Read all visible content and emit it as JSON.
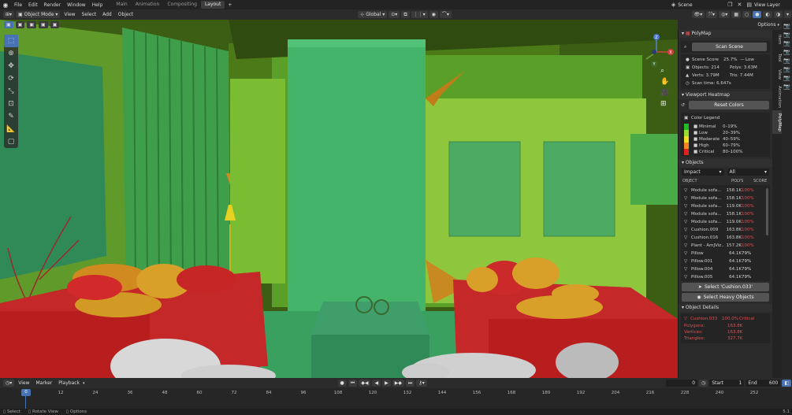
{
  "topbar": {
    "menus": [
      "File",
      "Edit",
      "Render",
      "Window",
      "Help"
    ],
    "workspaces": [
      "Main",
      "Animation",
      "Compositing",
      "Layout"
    ],
    "active_workspace": "Layout",
    "add_tab": "+",
    "scene": "Scene",
    "view_layer": "View Layer"
  },
  "header": {
    "mode": "Object Mode",
    "menus": [
      "View",
      "Select",
      "Add",
      "Object"
    ],
    "transform": "Global",
    "options": "Options"
  },
  "navigator": {
    "x_label": "X",
    "y_label": "Y",
    "z_label": "Z"
  },
  "polymap": {
    "title": "PolyMap",
    "scan_button": "Scan Scene",
    "stats": {
      "score_label": "Scene Score",
      "score_value": "25.7%",
      "score_rating": "Low",
      "objects": "Objects: 214",
      "polys": "Polys: 3.63M",
      "verts": "Verts: 3.79M",
      "tris": "Tris: 7.44M",
      "scan_time": "Scan time: 6.647s"
    },
    "heatmap_section": "Viewport Heatmap",
    "reset_button": "Reset Colors",
    "legend_title": "Color Legend",
    "legend": [
      {
        "name": "Minimal",
        "range": "0–19%",
        "color": "#22bb22"
      },
      {
        "name": "Low",
        "range": "20–39%",
        "color": "#99dd33"
      },
      {
        "name": "Moderate",
        "range": "40–59%",
        "color": "#eedd22"
      },
      {
        "name": "High",
        "range": "60–79%",
        "color": "#ee8822"
      },
      {
        "name": "Critical",
        "range": "80–100%",
        "color": "#dd2222"
      }
    ],
    "objects_section": "Objects",
    "sort": "Impact",
    "filter": "All",
    "columns": {
      "object": "OBJECT",
      "polys": "POLYS",
      "score": "SCORE"
    },
    "objects": [
      {
        "name": "Module sofa...",
        "polys": "158.1K",
        "score": "100%",
        "level": "critical"
      },
      {
        "name": "Module sofa...",
        "polys": "158.1K",
        "score": "100%",
        "level": "critical"
      },
      {
        "name": "Module sofa...",
        "polys": "119.0K",
        "score": "100%",
        "level": "critical"
      },
      {
        "name": "Module sofa...",
        "polys": "158.1K",
        "score": "100%",
        "level": "critical"
      },
      {
        "name": "Module sofa...",
        "polys": "119.0K",
        "score": "100%",
        "level": "critical"
      },
      {
        "name": "Cushion.009",
        "polys": "163.8K",
        "score": "100%",
        "level": "critical"
      },
      {
        "name": "Cushion.016",
        "polys": "163.8K",
        "score": "100%",
        "level": "critical"
      },
      {
        "name": "Plant - AmJViz...",
        "polys": "157.2K",
        "score": "100%",
        "level": "critical"
      },
      {
        "name": "Pillow",
        "polys": "64.1K",
        "score": "79%",
        "level": "high"
      },
      {
        "name": "Pillow.001",
        "polys": "64.1K",
        "score": "79%",
        "level": "high"
      },
      {
        "name": "Pillow.004",
        "polys": "64.1K",
        "score": "79%",
        "level": "high"
      },
      {
        "name": "Pillow.005",
        "polys": "64.1K",
        "score": "79%",
        "level": "high"
      }
    ],
    "select_button": "Select 'Cushion.033'",
    "select_heavy_button": "Select Heavy Objects",
    "details_section": "Object Details",
    "details": {
      "name": "Cushion.033",
      "score": "100.0%",
      "rating": "Critical",
      "polygons_label": "Polygons:",
      "polygons": "163.8K",
      "vertices_label": "Vertices:",
      "vertices": "163.8K",
      "triangles_label": "Triangles:",
      "triangles": "327.7K"
    }
  },
  "vtabs": [
    "Item",
    "Tool",
    "View",
    "Animation",
    "PolyMap"
  ],
  "active_vtab": "PolyMap",
  "timeline": {
    "menus": [
      "View",
      "Marker",
      "Playback"
    ],
    "current_frame": "0",
    "start_label": "Start",
    "start": "1",
    "end_label": "End",
    "end": "600",
    "ticks": [
      0,
      12,
      24,
      36,
      48,
      60,
      72,
      84,
      96,
      108,
      120,
      132,
      144,
      156,
      168,
      180,
      192,
      204,
      216,
      228,
      240,
      252
    ],
    "playhead": "0"
  },
  "status": {
    "select": "Select",
    "rotate": "Rotate View",
    "options": "Options",
    "version": "5.1"
  },
  "colors": {
    "accent": "#4772b3",
    "critical": "#e05050",
    "high": "#dddddd"
  }
}
